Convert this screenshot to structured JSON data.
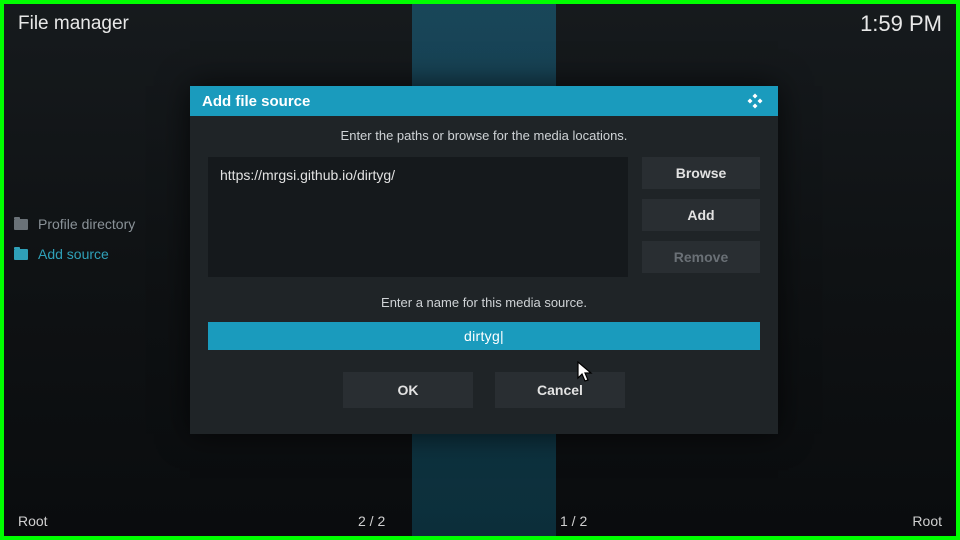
{
  "header": {
    "title": "File manager",
    "clock": "1:59 PM"
  },
  "sidebar": {
    "items": [
      {
        "label": "Profile directory"
      },
      {
        "label": "Add source"
      }
    ]
  },
  "dialog": {
    "title": "Add file source",
    "instruction1": "Enter the paths or browse for the media locations.",
    "path_value": "https://mrgsi.github.io/dirtyg/",
    "browse_label": "Browse",
    "add_label": "Add",
    "remove_label": "Remove",
    "instruction2": "Enter a name for this media source.",
    "name_value": "dirtyg|",
    "ok_label": "OK",
    "cancel_label": "Cancel"
  },
  "footer": {
    "left": "Root",
    "pager1": "2 / 2",
    "pager2": "1 / 2",
    "right": "Root"
  }
}
